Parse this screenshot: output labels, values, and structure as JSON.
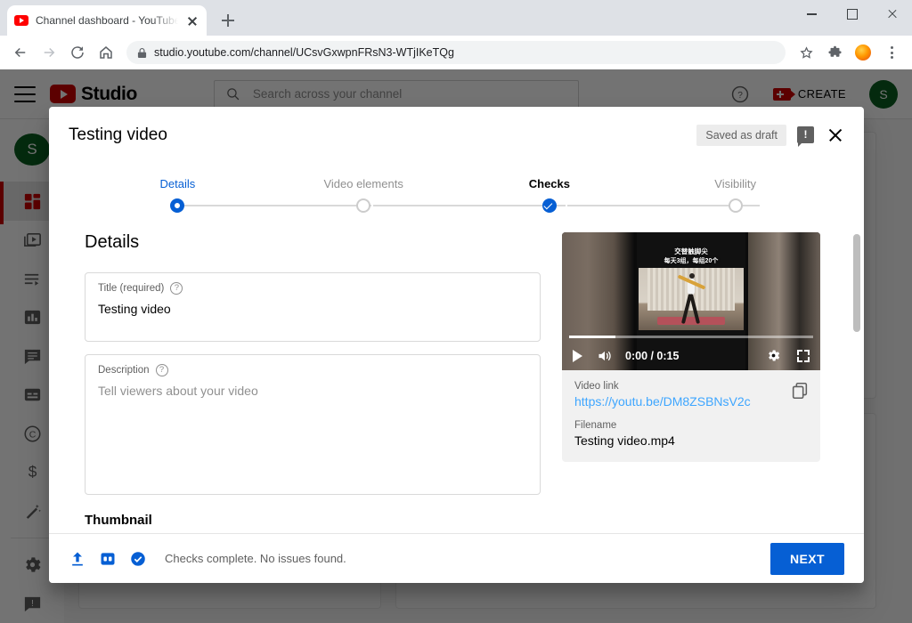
{
  "browser": {
    "tab": {
      "title": "Channel dashboard - YouTube St",
      "favicon": "youtube-icon",
      "close": "×"
    },
    "new_tab_tooltip": "New tab",
    "window_controls": {
      "minimize": "minimize-icon",
      "maximize": "maximize-icon",
      "close": "close-icon"
    },
    "toolbar": {
      "back": "back-arrow-icon",
      "forward": "forward-arrow-icon",
      "reload": "reload-icon",
      "home": "home-icon",
      "lock": "lock-icon",
      "url": "studio.youtube.com/channel/UCsvGxwpnFRsN3-WTjIKeTQg",
      "bookmark": "star-icon",
      "extensions": "puzzle-icon",
      "profile": "extension-orange-icon",
      "menu": "kebab-menu-icon"
    }
  },
  "studio": {
    "hamburger": "menu-icon",
    "logo_word": "Studio",
    "search": {
      "placeholder": "Search across your channel",
      "icon": "search-icon"
    },
    "help": "help-icon",
    "create": {
      "label": "CREATE",
      "icon": "video-camera-plus-icon"
    },
    "account_avatar": "S",
    "sidebar": {
      "avatar": "S",
      "items": [
        {
          "name": "dashboard",
          "icon": "dashboard-icon",
          "active": true
        },
        {
          "name": "content",
          "icon": "video-library-icon",
          "active": false
        },
        {
          "name": "playlists",
          "icon": "playlist-icon",
          "active": false
        },
        {
          "name": "analytics",
          "icon": "analytics-bar-icon",
          "active": false
        },
        {
          "name": "comments",
          "icon": "comment-icon",
          "active": false
        },
        {
          "name": "subtitles",
          "icon": "subtitles-icon",
          "active": false
        },
        {
          "name": "copyright",
          "icon": "copyright-icon",
          "active": false
        },
        {
          "name": "monetization",
          "icon": "dollar-icon",
          "active": false
        },
        {
          "name": "customization",
          "icon": "magic-wand-icon",
          "active": false
        },
        {
          "name": "settings",
          "icon": "gear-icon",
          "active": false
        },
        {
          "name": "send-feedback",
          "icon": "feedback-icon",
          "active": false
        }
      ]
    }
  },
  "dialog": {
    "title": "Testing video",
    "draft_badge": "Saved as draft",
    "issue_icon": "issue-alert-icon",
    "close_icon": "close-icon",
    "stepper": [
      {
        "label": "Details",
        "state": "current"
      },
      {
        "label": "Video elements",
        "state": "pending"
      },
      {
        "label": "Checks",
        "state": "done"
      },
      {
        "label": "Visibility",
        "state": "pending"
      }
    ],
    "details": {
      "heading": "Details",
      "title_field": {
        "label": "Title (required)",
        "help": "?",
        "value": "Testing video"
      },
      "description_field": {
        "label": "Description",
        "help": "?",
        "value": "",
        "placeholder": "Tell viewers about your video"
      },
      "thumbnail_heading": "Thumbnail"
    },
    "video_card": {
      "player": {
        "play_icon": "play-icon",
        "volume_icon": "volume-icon",
        "time": "0:00 / 0:15",
        "settings_icon": "gear-icon",
        "fullscreen_icon": "fullscreen-icon",
        "progress_percent": 0,
        "overlay_line1": "交替触脚尖",
        "overlay_line2": "每天3组，每组20个"
      },
      "video_link_label": "Video link",
      "video_link": "https://youtu.be/DM8ZSBNsV2c",
      "copy_icon": "copy-icon",
      "filename_label": "Filename",
      "filename": "Testing video.mp4"
    },
    "footer": {
      "upload_icon": "upload-icon",
      "quality_icon": "sd-quality-icon",
      "check_icon": "check-circle-icon",
      "status_text": "Checks complete. No issues found.",
      "next_label": "NEXT"
    }
  },
  "colors": {
    "brand_red": "#cc0000",
    "accent_blue": "#065fd4",
    "link_blue": "#3ea6ff",
    "avatar_green": "#0b5e20"
  }
}
